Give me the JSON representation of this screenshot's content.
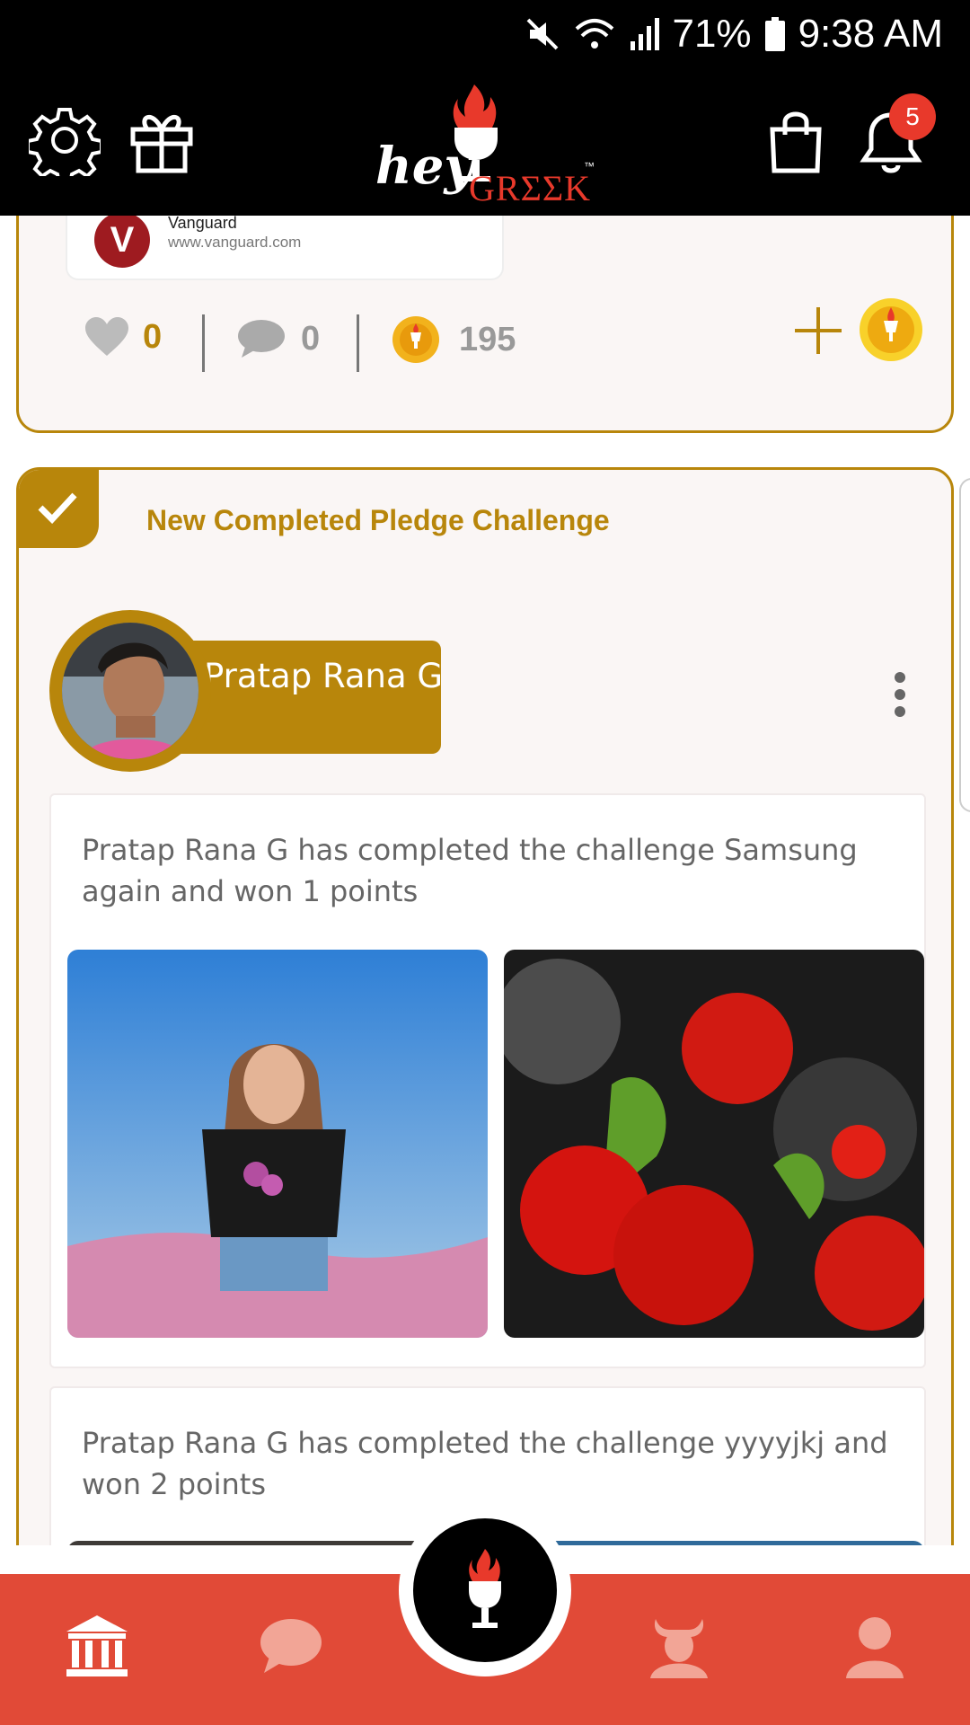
{
  "status_bar": {
    "battery": "71%",
    "time": "9:38 AM"
  },
  "header": {
    "logo_hey": "hey",
    "logo_greek": "GRΣΣK",
    "logo_tm": "™",
    "notification_count": "5"
  },
  "feed": {
    "previous_post": {
      "link_title": "Vanguard",
      "link_url": "www.vanguard.com",
      "link_logo_letter": "V",
      "likes": "0",
      "comments": "0",
      "coins": "195"
    },
    "pledge_card": {
      "title": "New Completed Pledge Challenge",
      "user_name": "Pratap Rana G",
      "posts": [
        {
          "text": "Pratap Rana G has completed the challenge Samsung again and won 1 points"
        },
        {
          "text": "Pratap Rana G has completed the challenge yyyyjkj and won 2 points"
        }
      ]
    }
  },
  "bottom_nav": {
    "items": [
      "museum-icon",
      "chat-icon",
      "trophy-icon",
      "minotaur-icon",
      "profile-icon"
    ]
  },
  "colors": {
    "gold": "#b8860b",
    "brand_red": "#e14a37",
    "dark": "#000000"
  }
}
